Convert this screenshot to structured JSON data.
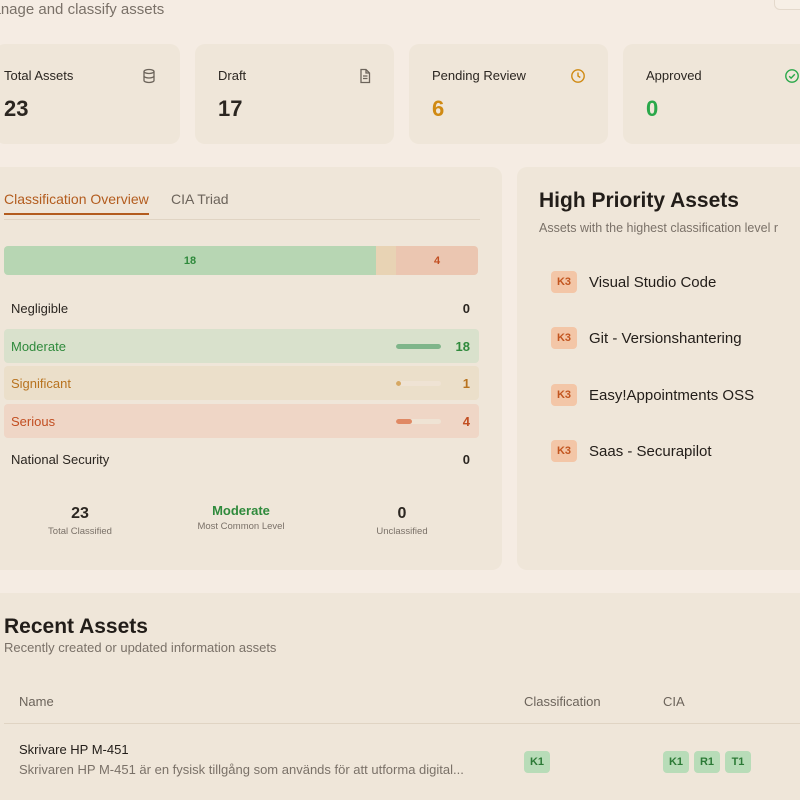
{
  "header": {
    "subtitle": "Manage and classify assets"
  },
  "stats": [
    {
      "label": "Total Assets",
      "value": "23",
      "icon": "database-icon",
      "color": "#2b2621"
    },
    {
      "label": "Draft",
      "value": "17",
      "icon": "document-icon",
      "color": "#2b2621"
    },
    {
      "label": "Pending Review",
      "value": "6",
      "icon": "clock-icon",
      "color": "#d08a13"
    },
    {
      "label": "Approved",
      "value": "0",
      "icon": "check-circle-icon",
      "color": "#2aa84a"
    }
  ],
  "classification": {
    "tabs": [
      "Classification Overview",
      "CIA Triad"
    ],
    "active_tab": 0,
    "bar": {
      "moderate_label": "18",
      "serious_label": "4",
      "counts": {
        "moderate": 18,
        "significant": 1,
        "serious": 4
      }
    },
    "levels": [
      {
        "name": "Negligible",
        "count": "0",
        "share": 0,
        "color": "#2b2621"
      },
      {
        "name": "Moderate",
        "count": "18",
        "share": 0.78,
        "color": "#2f8a3c"
      },
      {
        "name": "Significant",
        "count": "1",
        "share": 0.04,
        "color": "#b8731f"
      },
      {
        "name": "Serious",
        "count": "4",
        "share": 0.17,
        "color": "#c24e21"
      },
      {
        "name": "National Security",
        "count": "0",
        "share": 0,
        "color": "#2b2621"
      }
    ],
    "summary": {
      "total_classified_value": "23",
      "total_classified_label": "Total Classified",
      "common_value": "Moderate",
      "common_label": "Most Common Level",
      "unclassified_value": "0",
      "unclassified_label": "Unclassified"
    }
  },
  "high_priority": {
    "title": "High Priority Assets",
    "subtitle": "Assets with the highest classification level r",
    "items": [
      {
        "badge": "K3",
        "name": "Visual Studio Code"
      },
      {
        "badge": "K3",
        "name": "Git - Versionshantering"
      },
      {
        "badge": "K3",
        "name": "Easy!Appointments OSS"
      },
      {
        "badge": "K3",
        "name": "Saas - Securapilot"
      }
    ]
  },
  "recent": {
    "title": "Recent Assets",
    "subtitle": "Recently created or updated information assets",
    "columns": [
      "Name",
      "Classification",
      "CIA"
    ],
    "rows": [
      {
        "name": "Skrivare HP M-451",
        "description": "Skrivaren HP M-451 är en fysisk tillgång som används för att utforma digital...",
        "classification": "K1",
        "cia": [
          "K1",
          "R1",
          "T1"
        ]
      }
    ]
  }
}
